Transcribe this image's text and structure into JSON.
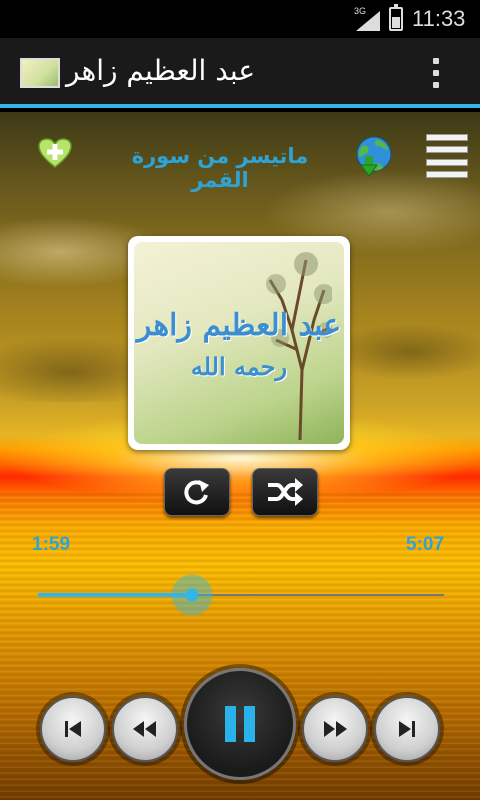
{
  "status_bar": {
    "network": "3G",
    "time": "11:33",
    "battery_level": 0.55
  },
  "action_bar": {
    "title": "عبد العظيم زاهر",
    "app_icon": "album-thumbnail-icon",
    "overflow_icon": "overflow-menu-icon"
  },
  "player": {
    "track_title": "ماتيسر من سورة القمر",
    "album_art": {
      "line1": "عبد العظيم زاهر",
      "line2": "رحمه الله"
    },
    "elapsed": "1:59",
    "duration": "5:07",
    "progress_fraction": 0.38,
    "accent_color": "#33b5e5",
    "text_color": "#2ea3d6",
    "icons": {
      "favorite": "heart-add-icon",
      "download": "globe-download-icon",
      "playlist": "menu-icon",
      "repeat": "repeat-icon",
      "shuffle": "shuffle-icon",
      "previous": "skip-previous-icon",
      "rewind": "rewind-icon",
      "play_pause": "pause-icon",
      "forward": "fast-forward-icon",
      "next": "skip-next-icon"
    }
  }
}
